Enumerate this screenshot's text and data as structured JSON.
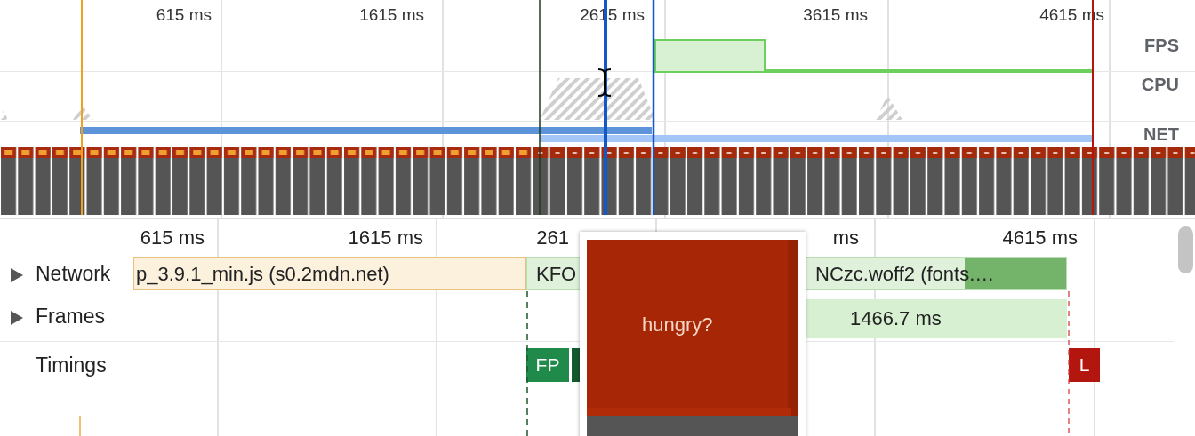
{
  "overview": {
    "ticks": [
      "615 ms",
      "1615 ms",
      "2615 ms",
      "3615 ms",
      "4615 ms"
    ],
    "lanes": [
      "FPS",
      "CPU",
      "NET"
    ]
  },
  "details": {
    "ticks": [
      "615 ms",
      "1615 ms",
      "261",
      "ms",
      "4615 ms"
    ],
    "tracks": [
      {
        "label": "Network",
        "kind": "group",
        "expanded": false,
        "items": [
          {
            "text": "p_3.9.1_min.js (s0.2mdn.net)",
            "kind": "script"
          },
          {
            "text": "KFO",
            "kind": "font"
          },
          {
            "text": "NCzc.woff2 (fonts.…",
            "kind": "font"
          }
        ]
      },
      {
        "label": "Frames",
        "kind": "group",
        "expanded": false,
        "items": [
          {
            "text": "1466.7 ms",
            "kind": "frame"
          }
        ]
      },
      {
        "label": "Timings",
        "kind": "plain",
        "items": [
          {
            "text": "FP",
            "kind": "mark",
            "color": "#1f8a4a"
          },
          {
            "kind": "mark",
            "color": "#13592f"
          },
          {
            "text": "L",
            "kind": "mark",
            "color": "#b3150f"
          }
        ]
      }
    ]
  },
  "tooltip": {
    "screenshot_text": "hungry?"
  }
}
